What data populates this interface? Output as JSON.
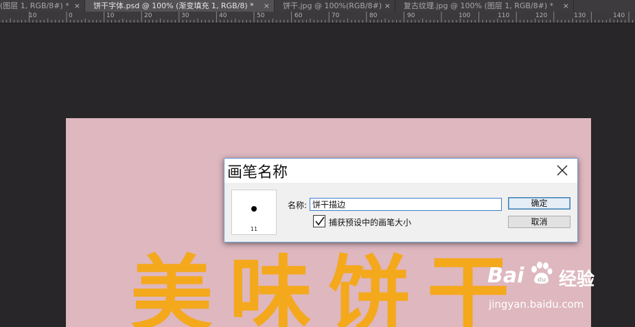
{
  "tabs": [
    {
      "label": "(图层 1, RGB/8#) *",
      "close": "×",
      "active": false
    },
    {
      "label": "饼干字体.psd @ 100% (渐变填充 1, RGB/8) *",
      "close": "×",
      "active": true
    },
    {
      "label": "饼干.jpg @ 100%(RGB/8#)",
      "close": "×",
      "active": false
    },
    {
      "label": "复古纹理.jpg @ 100% (图层 1, RGB/8#) *",
      "close": "×",
      "active": false
    }
  ],
  "ruler": {
    "numbers": [
      "10",
      "0",
      "10",
      "20",
      "30",
      "40",
      "50",
      "60",
      "70",
      "80",
      "90",
      "100",
      "110",
      "120",
      "130",
      "140"
    ]
  },
  "canvas": {
    "artwork_text": "美味饼干",
    "background_color": "#deb7bf",
    "text_color": "#f4a81c"
  },
  "dialog": {
    "title": "画笔名称",
    "close_icon": "close-icon",
    "preview_size": "11",
    "name_label": "名称:",
    "name_value": "饼干描边",
    "checkbox_label": "捕获预设中的画笔大小",
    "checkbox_checked": true,
    "ok_label": "确定",
    "cancel_label": "取消"
  },
  "watermark": {
    "brand_latin": "Bai",
    "brand_cn": "经验",
    "url": "jingyan.baidu.com"
  }
}
